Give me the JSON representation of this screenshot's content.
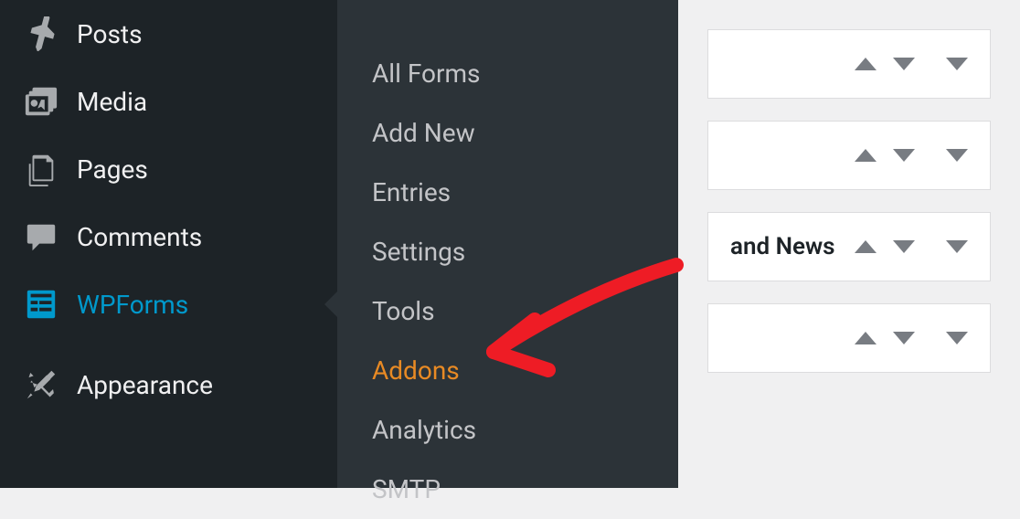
{
  "sidebar": {
    "items": [
      {
        "label": "Posts"
      },
      {
        "label": "Media"
      },
      {
        "label": "Pages"
      },
      {
        "label": "Comments"
      },
      {
        "label": "WPForms"
      },
      {
        "label": "Appearance"
      }
    ]
  },
  "submenu": {
    "items": [
      {
        "label": "All Forms"
      },
      {
        "label": "Add New"
      },
      {
        "label": "Entries"
      },
      {
        "label": "Settings"
      },
      {
        "label": "Tools"
      },
      {
        "label": "Addons"
      },
      {
        "label": "Analytics"
      },
      {
        "label": "SMTP"
      }
    ]
  },
  "widgets": {
    "items": [
      {
        "text": ""
      },
      {
        "text": ""
      },
      {
        "text": "and News"
      },
      {
        "text": ""
      }
    ]
  }
}
